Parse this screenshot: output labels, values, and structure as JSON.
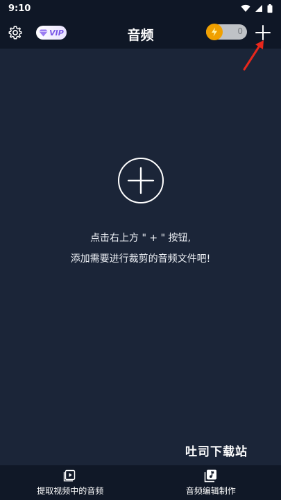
{
  "status_bar": {
    "time": "9:10",
    "icons": [
      "wifi-icon",
      "signal-icon",
      "battery-icon"
    ]
  },
  "header": {
    "settings_icon": "gear-icon",
    "vip_label": "VIP",
    "title": "音频",
    "coin_count": "0",
    "add_icon": "plus-icon"
  },
  "main": {
    "empty_line_1": "点击右上方 \" + \" 按钮,",
    "empty_line_2": "添加需要进行裁剪的音频文件吧!",
    "watermark": "吐司下载站"
  },
  "bottom_tabs": [
    {
      "label": "提取视频中的音频",
      "icon": "video-extract-icon"
    },
    {
      "label": "音频编辑制作",
      "icon": "music-edit-icon"
    }
  ],
  "colors": {
    "background": "#1b2538",
    "header": "#0f1726",
    "vip_text": "#7a57e8",
    "coin": "#f0a000",
    "arrow": "#e8271c"
  }
}
